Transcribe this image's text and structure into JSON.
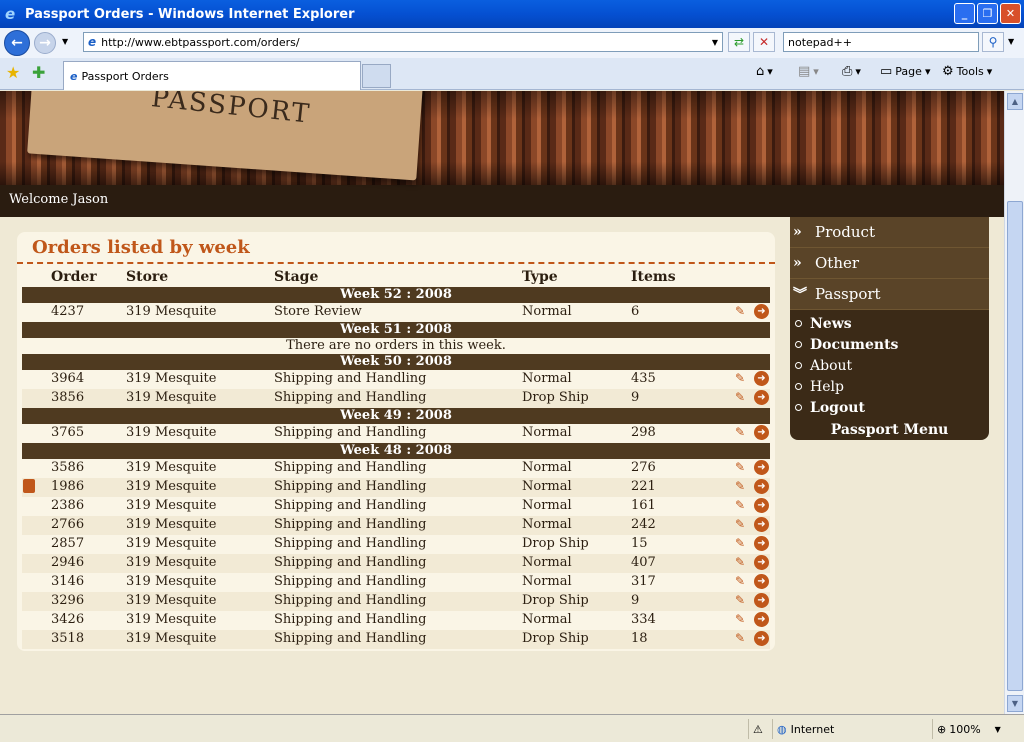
{
  "window": {
    "title": "Passport Orders - Windows Internet Explorer"
  },
  "browser": {
    "url": "http://www.ebtpassport.com/orders/",
    "search_value": "notepad++",
    "tab_title": "Passport Orders",
    "page_label": "Page",
    "tools_label": "Tools"
  },
  "banner": {
    "logo_text": "PASSPORT"
  },
  "welcome": "Welcome Jason",
  "orders": {
    "title": "Orders listed by week",
    "columns": [
      "Order",
      "Store",
      "Stage",
      "Type",
      "Items"
    ],
    "empty_message": "There are no orders in this week.",
    "weeks": [
      {
        "label": "Week 52 : 2008",
        "rows": [
          [
            "4237",
            "319 Mesquite",
            "Store Review",
            "Normal",
            "6"
          ]
        ]
      },
      {
        "label": "Week 51 : 2008",
        "rows": []
      },
      {
        "label": "Week 50 : 2008",
        "rows": [
          [
            "3964",
            "319 Mesquite",
            "Shipping and Handling",
            "Normal",
            "435"
          ],
          [
            "3856",
            "319 Mesquite",
            "Shipping and Handling",
            "Drop Ship",
            "9"
          ]
        ]
      },
      {
        "label": "Week 49 : 2008",
        "rows": [
          [
            "3765",
            "319 Mesquite",
            "Shipping and Handling",
            "Normal",
            "298"
          ]
        ]
      },
      {
        "label": "Week 48 : 2008",
        "rows": [
          [
            "3586",
            "319 Mesquite",
            "Shipping and Handling",
            "Normal",
            "276"
          ],
          [
            "1986",
            "319 Mesquite",
            "Shipping and Handling",
            "Normal",
            "221"
          ],
          [
            "2386",
            "319 Mesquite",
            "Shipping and Handling",
            "Normal",
            "161"
          ],
          [
            "2766",
            "319 Mesquite",
            "Shipping and Handling",
            "Normal",
            "242"
          ],
          [
            "2857",
            "319 Mesquite",
            "Shipping and Handling",
            "Drop Ship",
            "15"
          ],
          [
            "2946",
            "319 Mesquite",
            "Shipping and Handling",
            "Normal",
            "407"
          ],
          [
            "3146",
            "319 Mesquite",
            "Shipping and Handling",
            "Normal",
            "317"
          ],
          [
            "3296",
            "319 Mesquite",
            "Shipping and Handling",
            "Drop Ship",
            "9"
          ],
          [
            "3426",
            "319 Mesquite",
            "Shipping and Handling",
            "Normal",
            "334"
          ],
          [
            "3518",
            "319 Mesquite",
            "Shipping and Handling",
            "Drop Ship",
            "18"
          ]
        ]
      }
    ],
    "locked_order": "1986"
  },
  "sidebar": {
    "sections": [
      "Product",
      "Other",
      "Passport"
    ],
    "menu_items": [
      {
        "label": "News",
        "bold": true
      },
      {
        "label": "Documents",
        "bold": true
      },
      {
        "label": "About",
        "bold": false
      },
      {
        "label": "Help",
        "bold": false
      },
      {
        "label": "Logout",
        "bold": true
      }
    ],
    "menu_title": "Passport Menu"
  },
  "status": {
    "zone": "Internet",
    "zoom": "100%"
  },
  "colors": {
    "accent": "#c0571a",
    "dark": "#2a1c10",
    "week_bar": "#4f3a20"
  }
}
